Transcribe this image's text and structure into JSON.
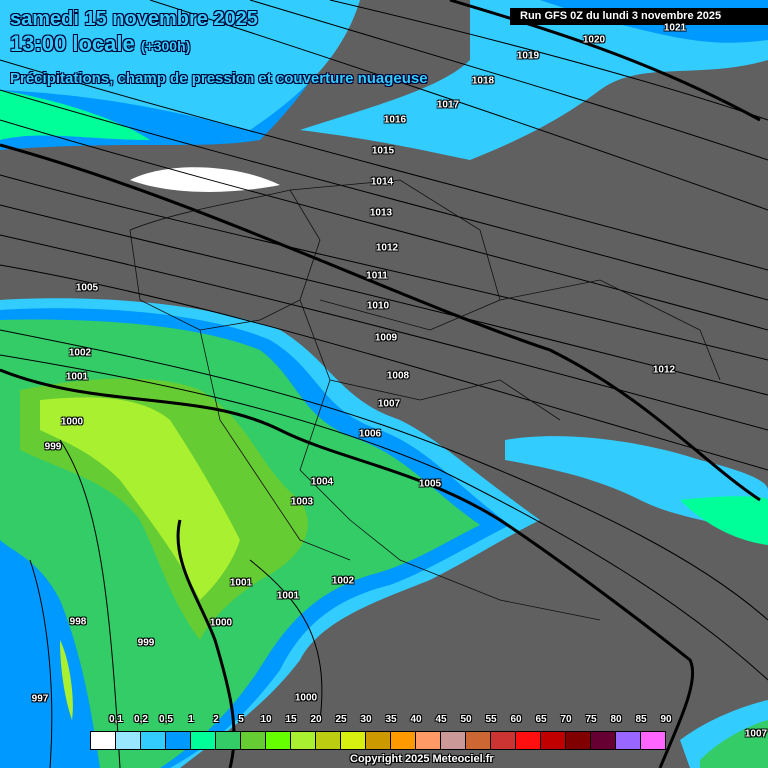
{
  "header": {
    "date": "samedi 15 novembre 2025",
    "time": "13:00 locale",
    "lead": "(+300h)",
    "subtitle": "Précipitations, champ de pression et couverture nuageuse",
    "run": "Run GFS 0Z du lundi 3 novembre 2025"
  },
  "isobar_labels": [
    "1021",
    "1020",
    "1019",
    "1018",
    "1017",
    "1016",
    "1015",
    "1014",
    "1013",
    "1012",
    "1011",
    "1010",
    "1009",
    "1008",
    "1007",
    "1006",
    "1005",
    "1004",
    "1003",
    "1002",
    "1001",
    "1001",
    "1000",
    "1000",
    "999",
    "998",
    "997",
    "1005",
    "1002",
    "1001",
    "1000",
    "999",
    "1012",
    "1007"
  ],
  "legend": {
    "unit_ticks": [
      "0,1",
      "0,2",
      "0,5",
      "1",
      "2",
      "5",
      "10",
      "15",
      "20",
      "25",
      "30",
      "35",
      "40",
      "45",
      "50",
      "55",
      "60",
      "65",
      "70",
      "75",
      "80",
      "85",
      "90"
    ],
    "colors": [
      "#ffffff",
      "#99e6ff",
      "#33ccff",
      "#0099ff",
      "#00ff99",
      "#33cc66",
      "#66cc33",
      "#66ff00",
      "#a8f030",
      "#bccc10",
      "#d8f010",
      "#cc9900",
      "#ff9900",
      "#ff9966",
      "#cc9999",
      "#cc6633",
      "#cc3333",
      "#ff0f0f",
      "#c00000",
      "#800000",
      "#660033",
      "#9966ff",
      "#ff66ff"
    ]
  },
  "copyright": "Copyright 2025 Meteociel.fr"
}
